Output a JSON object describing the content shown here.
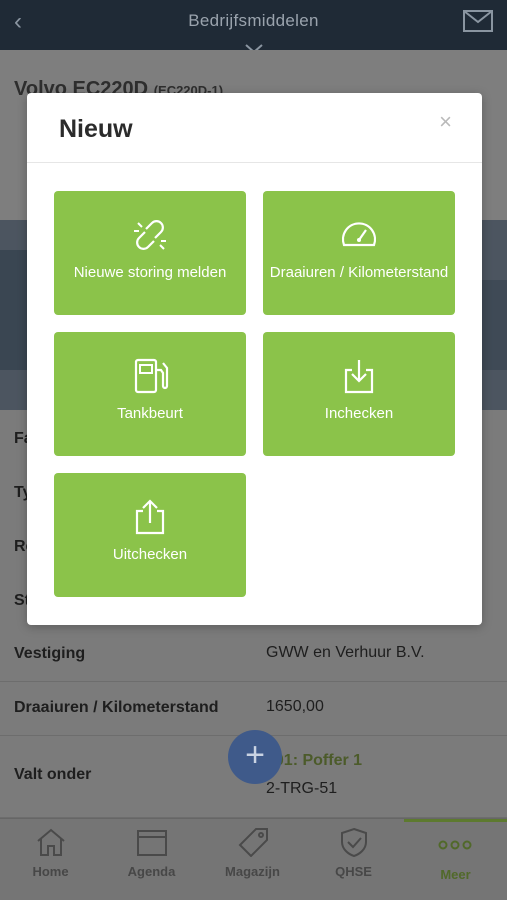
{
  "topbar": {
    "title": "Bedrijfsmiddelen",
    "back_icon": "chevron-left-icon",
    "mail_icon": "mail-icon"
  },
  "detail": {
    "title": "Volvo EC220D",
    "title_code": "(EC220D-1)",
    "partial_rows": [
      "Fa",
      "Ty",
      "Re",
      "St"
    ],
    "rows": [
      {
        "label": "Vestiging",
        "value": "GWW en Verhuur B.V."
      },
      {
        "label": "Draaiuren / Kilometerstand",
        "value": "1650,00"
      },
      {
        "label": "Valt onder",
        "value": "001: Poffer 1",
        "value2": "2-TRG-51"
      }
    ]
  },
  "fab": {
    "label": "+"
  },
  "bottomnav": [
    {
      "label": "Home",
      "icon": "home-icon"
    },
    {
      "label": "Agenda",
      "icon": "calendar-icon"
    },
    {
      "label": "Magazijn",
      "icon": "tag-icon"
    },
    {
      "label": "QHSE",
      "icon": "shield-check-icon"
    },
    {
      "label": "Meer",
      "icon": "more-dots-icon",
      "active": true
    }
  ],
  "modal": {
    "title": "Nieuw",
    "close": "×",
    "tiles": [
      {
        "label": "Nieuwe storing melden",
        "icon": "broken-link-icon"
      },
      {
        "label": "Draaiuren / Kilometerstand",
        "icon": "speedometer-icon"
      },
      {
        "label": "Tankbeurt",
        "icon": "fuel-pump-icon"
      },
      {
        "label": "Inchecken",
        "icon": "check-in-icon"
      },
      {
        "label": "Uitchecken",
        "icon": "check-out-icon"
      }
    ]
  },
  "colors": {
    "tile": "#8bc34a",
    "header": "#1f2a36",
    "accent": "#5d7a2f"
  }
}
